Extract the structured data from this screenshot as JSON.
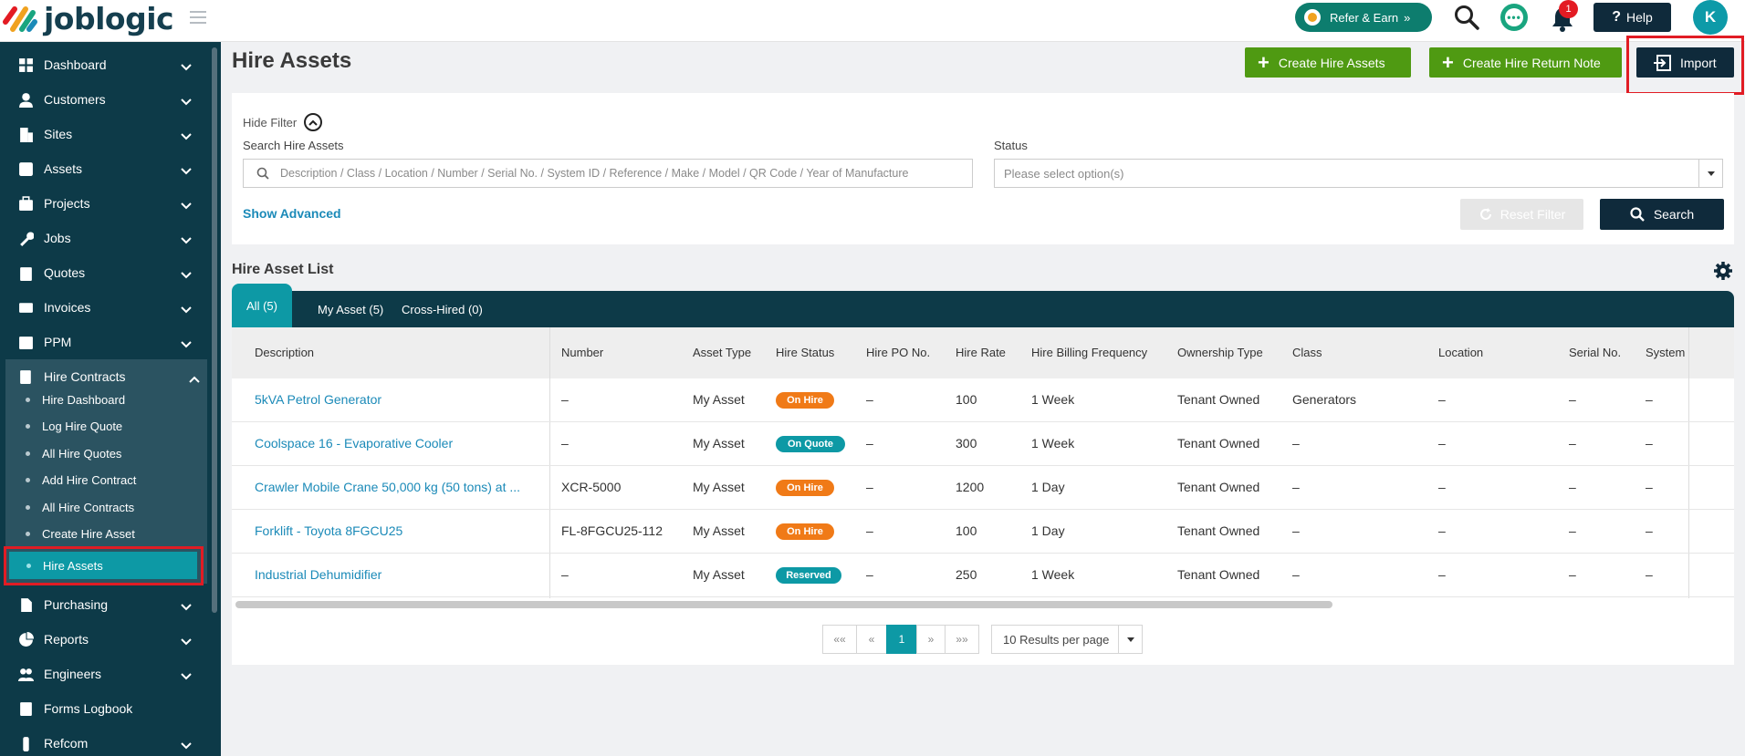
{
  "brand": {
    "name": "joblogic"
  },
  "topbar": {
    "refer_label": "Refer & Earn",
    "refer_chevron": "»",
    "help_label": "Help",
    "notifications_count": "1",
    "avatar_initial": "K",
    "icons": [
      "menu-icon",
      "search-icon",
      "chat-icon",
      "bell-icon",
      "question-icon"
    ]
  },
  "sidebar": {
    "items": [
      {
        "label": "Dashboard",
        "icon": "dashboard-icon"
      },
      {
        "label": "Customers",
        "icon": "user-icon"
      },
      {
        "label": "Sites",
        "icon": "building-icon"
      },
      {
        "label": "Assets",
        "icon": "asset-icon"
      },
      {
        "label": "Projects",
        "icon": "briefcase-icon"
      },
      {
        "label": "Jobs",
        "icon": "wrench-icon"
      },
      {
        "label": "Quotes",
        "icon": "clipboard-icon"
      },
      {
        "label": "Invoices",
        "icon": "card-icon"
      },
      {
        "label": "PPM",
        "icon": "calendar-icon"
      },
      {
        "label": "Hire Contracts",
        "icon": "contract-icon"
      },
      {
        "label": "Purchasing",
        "icon": "document-icon"
      },
      {
        "label": "Reports",
        "icon": "pie-chart-icon"
      },
      {
        "label": "Engineers",
        "icon": "users-icon"
      },
      {
        "label": "Forms Logbook",
        "icon": "book-icon"
      },
      {
        "label": "Refcom",
        "icon": "refcom-icon"
      }
    ],
    "hire_submenu": [
      "Hire Dashboard",
      "Log Hire Quote",
      "All Hire Quotes",
      "Add Hire Contract",
      "All Hire Contracts",
      "Create Hire Asset",
      "Hire Assets"
    ],
    "active_item": "Hire Assets"
  },
  "page": {
    "title": "Hire Assets",
    "create_label": "Create Hire Assets",
    "return_label": "Create Hire Return Note",
    "import_label": "Import"
  },
  "filter": {
    "hide_label": "Hide Filter",
    "search_label": "Search Hire Assets",
    "search_placeholder": "Description / Class / Location / Number / Serial No. / System ID / Reference / Make / Model / QR Code / Year of Manufacture",
    "status_label": "Status",
    "status_placeholder": "Please select option(s)",
    "show_advanced": "Show Advanced",
    "reset_label": "Reset Filter",
    "search_button": "Search"
  },
  "list": {
    "title": "Hire Asset List",
    "tabs": [
      {
        "label": "All",
        "count": "(5)"
      },
      {
        "label": "My Asset",
        "count": "(5)"
      },
      {
        "label": "Cross-Hired",
        "count": "(0)"
      }
    ],
    "columns": [
      "Description",
      "Number",
      "Asset Type",
      "Hire Status",
      "Hire PO No.",
      "Hire Rate",
      "Hire Billing Frequency",
      "Ownership Type",
      "Class",
      "Location",
      "Serial No.",
      "System"
    ],
    "rows": [
      {
        "description": "5kVA Petrol Generator",
        "number": "–",
        "asset_type": "My Asset",
        "status": "On Hire",
        "po": "–",
        "rate": "100",
        "frequency": "1 Week",
        "ownership": "Tenant Owned",
        "class": "Generators",
        "location": "–",
        "serial": "–",
        "system": "–"
      },
      {
        "description": "Coolspace 16 - Evaporative Cooler",
        "number": "–",
        "asset_type": "My Asset",
        "status": "On Quote",
        "po": "–",
        "rate": "300",
        "frequency": "1 Week",
        "ownership": "Tenant Owned",
        "class": "–",
        "location": "–",
        "serial": "–",
        "system": "–"
      },
      {
        "description": "Crawler Mobile Crane 50,000 kg (50 tons) at ...",
        "number": "XCR-5000",
        "asset_type": "My Asset",
        "status": "On Hire",
        "po": "–",
        "rate": "1200",
        "frequency": "1 Day",
        "ownership": "Tenant Owned",
        "class": "–",
        "location": "–",
        "serial": "–",
        "system": "–"
      },
      {
        "description": "Forklift - Toyota 8FGCU25",
        "number": "FL-8FGCU25-112",
        "asset_type": "My Asset",
        "status": "On Hire",
        "po": "–",
        "rate": "100",
        "frequency": "1 Day",
        "ownership": "Tenant Owned",
        "class": "–",
        "location": "–",
        "serial": "–",
        "system": "–"
      },
      {
        "description": "Industrial Dehumidifier",
        "number": "–",
        "asset_type": "My Asset",
        "status": "Reserved",
        "po": "–",
        "rate": "250",
        "frequency": "1 Week",
        "ownership": "Tenant Owned",
        "class": "–",
        "location": "–",
        "serial": "–",
        "system": "–"
      }
    ],
    "status_colors": {
      "On Hire": "#f07a17",
      "On Quote": "#0d99a5",
      "Reserved": "#0d99a5"
    }
  },
  "pagination": {
    "first": "««",
    "prev": "«",
    "current": "1",
    "next": "»",
    "last": "»»",
    "per_page": "10 Results per page"
  },
  "colors": {
    "sidebar": "#0d3a48",
    "accent": "#0d99a5",
    "green": "#4f9a12",
    "dark_button": "#0f2a3b",
    "highlight": "#e11c24"
  }
}
